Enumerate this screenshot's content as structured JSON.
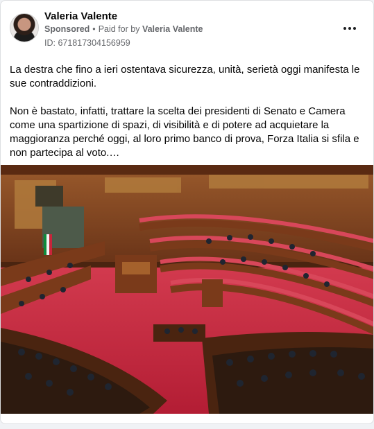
{
  "post": {
    "author": "Valeria Valente",
    "sponsored_label": "Sponsored",
    "separator": "•",
    "paid_prefix": "Paid for by",
    "paid_name": "Valeria Valente",
    "ad_id": "ID: 671817304156959",
    "paragraph_1": "La destra che fino a ieri ostentava sicurezza, unità, serietà oggi manifesta le sue contraddizioni.",
    "paragraph_2": "Non è bastato, infatti, trattare la scelta dei presidenti di Senato e Camera come una spartizione di spazi, di visibilità e di potere ad acquietare la maggioranza perché oggi, al loro primo banco di prova, Forza Italia si sfila e non partecipa al voto.…"
  },
  "icons": {
    "more": "more-horizontal-icon"
  },
  "colors": {
    "card_background": "#ffffff",
    "secondary_text": "#65676b",
    "carpet_red": "#c8243a",
    "wood": "#8a4a24"
  }
}
